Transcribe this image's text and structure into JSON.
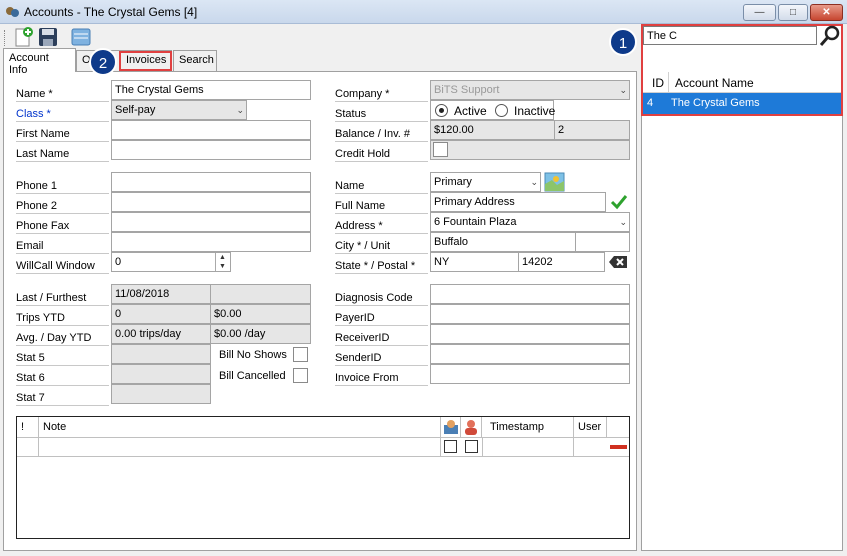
{
  "window": {
    "title": "Accounts - The Crystal Gems [4]"
  },
  "tabs": [
    "Account Info",
    "O",
    "Invoices",
    "Search"
  ],
  "form": {
    "name_label": "Name *",
    "name_value": "The Crystal Gems",
    "class_label": "Class *",
    "class_value": "Self-pay",
    "first_name_label": "First Name",
    "last_name_label": "Last Name",
    "phone1_label": "Phone 1",
    "phone2_label": "Phone 2",
    "phone_fax_label": "Phone Fax",
    "email_label": "Email",
    "willcall_label": "WillCall Window",
    "willcall_value": "0",
    "last_furthest_label": "Last / Furthest",
    "last_furthest_value": "11/08/2018",
    "trips_ytd_label": "Trips YTD",
    "trips_ytd_value": "0",
    "trips_ytd_amount": "$0.00",
    "avg_day_label": "Avg. / Day YTD",
    "avg_day_trips": "0.00 trips/day",
    "avg_day_amount": "$0.00 /day",
    "stat5_label": "Stat 5",
    "stat6_label": "Stat 6",
    "stat7_label": "Stat 7",
    "bill_no_shows_label": "Bill No Shows",
    "bill_cancelled_label": "Bill Cancelled",
    "company_label": "Company *",
    "company_value": "BiTS Support",
    "status_label": "Status",
    "status_active": "Active",
    "status_inactive": "Inactive",
    "balance_label": "Balance / Inv. #",
    "balance_value": "$120.00",
    "inv_count": "2",
    "credit_hold_label": "Credit Hold",
    "addr_name_label": "Name",
    "addr_name_value": "Primary",
    "full_name_label": "Full Name",
    "full_name_value": "Primary Address",
    "address_label": "Address *",
    "address_value": "6 Fountain Plaza",
    "city_label": "City * / Unit",
    "city_value": "Buffalo",
    "state_label": "State * / Postal *",
    "state_value": "NY",
    "postal_value": "14202",
    "diagnosis_label": "Diagnosis Code",
    "payer_label": "PayerID",
    "receiver_label": "ReceiverID",
    "sender_label": "SenderID",
    "invoice_from_label": "Invoice From"
  },
  "notes_grid": {
    "col_bang": "!",
    "col_note": "Note",
    "col_timestamp": "Timestamp",
    "col_user": "User"
  },
  "search": {
    "value": "The C",
    "col_id": "ID",
    "col_name": "Account Name",
    "rows": [
      {
        "id": "4",
        "name": "The Crystal Gems"
      }
    ]
  },
  "badges": {
    "one": "1",
    "two": "2"
  },
  "colors": {
    "selection": "#1e7ad8",
    "highlight_box": "#e04040",
    "badge": "#0e3a8a"
  }
}
